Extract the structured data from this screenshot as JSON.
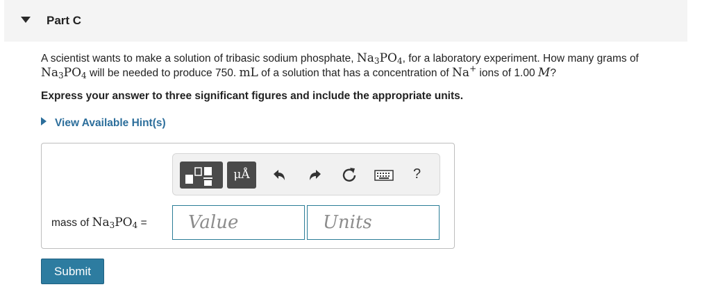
{
  "part": {
    "title": "Part C"
  },
  "question": {
    "t1": "A scientist wants to make a solution of tribasic sodium phosphate, ",
    "formula_na": "Na",
    "formula_3": "3",
    "formula_po": "PO",
    "formula_4": "4",
    "t2": ", for a laboratory experiment. How many grams of ",
    "t3": " will be needed to produce 750. ",
    "unit_ml": "mL",
    "t4": " of a solution that has a concentration of ",
    "ion": "Na",
    "ion_charge": "+",
    "t5": " ions of 1.00 ",
    "molar": "M",
    "t6": "?"
  },
  "instruction": "Express your answer to three significant figures and include the appropriate units.",
  "hint": {
    "label": "View Available Hint(s)"
  },
  "toolbar": {
    "icons": [
      "templates-icon",
      "units-icon",
      "undo-icon",
      "redo-icon",
      "reset-icon",
      "keyboard-icon",
      "help-icon"
    ],
    "units_label": "μÅ",
    "help_label": "?"
  },
  "answer": {
    "label_prefix": "mass of ",
    "label_suffix": " =",
    "value_placeholder": "Value",
    "units_placeholder": "Units"
  },
  "submit": {
    "label": "Submit"
  },
  "colors": {
    "accent": "#2d7ca0",
    "link": "#2c6e9b",
    "input_border": "#2a7c97",
    "header_bg": "#f4f4f4"
  }
}
